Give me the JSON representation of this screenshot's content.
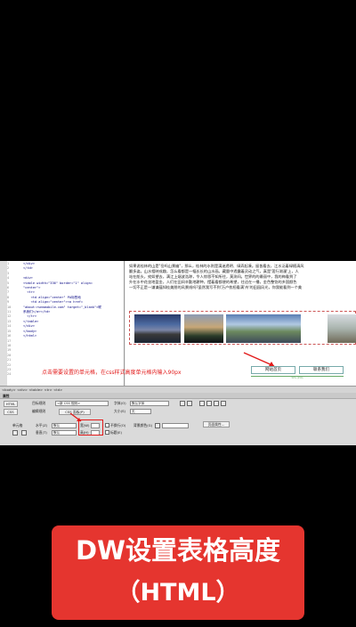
{
  "code_view": {
    "line_numbers": [
      "1",
      "2",
      "3",
      "4",
      "5",
      "6",
      "7",
      "8",
      "9",
      "10",
      "11",
      "12",
      "13",
      "14",
      "15",
      "16",
      "17",
      "18",
      "19",
      "20",
      "21",
      "22",
      "23",
      "24"
    ],
    "lines": [
      "</div>",
      "</td>",
      "",
      "<div>",
      "<table width=\"336\" border=\"1\" align=",
      "\"center\">",
      "  <tr>",
      "    <td align=\"center\" PA标签地",
      "    <td align=\"center\"><a href=",
      "\"about:rumsmobile.com\" target=\"_blank\">联",
      "系我们</a></td>",
      "  </tr>",
      "</table>",
      "</div>",
      "</body>",
      "</html>"
    ]
  },
  "design_view": {
    "paragraph_lines": [
      "如果说桂林的山是\"岳吗山景幽\"，那么，桂林的水则是漓迷透明、绿弄起凑。留皆看去，江水泛着绿随清风",
      "翻多姿。山水相映成趣，怎么看都是一幅长长的山水画。藏量中透露着灵动之气，真是'莲行湖漫'上，人",
      "站在船头，宛如望去，满江上烟波浩渺，令人惊恩不知所往，莫测间。世界的的最丽中，我的梅看到了",
      "升在水中花坐地盈金，人们在田间辛勤地耕种，摆着看都便的希望，往还在一播，金色整饬的乡国颜色",
      "一切不正是一谦谦蕴知桂美朋的风景线吗?虽然我写不到'万户枕桓看满'舟'的田园风光，你我能看到一个美"
    ],
    "instruction_note": "点击需要设置的单元格，在css样式高度单元格内输入90px",
    "link_cell_1": "网站首页",
    "link_cell_2": "联系我们",
    "width_indicator": "50% (150)"
  },
  "status_bar": {
    "text": "<body> <div> <table> <tr> <td>"
  },
  "properties": {
    "title": "属性",
    "html_tab": "HTML",
    "css_tab": "CSS",
    "target_rule_label": "目标规则",
    "target_rule_value": "<新 CSS 规则>",
    "edit_rule_label": "编辑规则",
    "css_panel_label": "CSS 面板(P)",
    "font_label": "字体(O)",
    "font_value": "默认字体",
    "size_label": "大小(S)",
    "size_value": "无",
    "cell_label": "单元格",
    "horz_label": "水平(Z)",
    "horz_value": "默认",
    "vert_label": "垂直(T)",
    "vert_value": "默认",
    "width_label": "宽(W)",
    "height_label": "高(H)",
    "nowrap_label": "不换行(O)",
    "header_label": "标题(E)",
    "bg_label": "背景颜色(G)",
    "page_props_label": "页面属性..."
  },
  "caption": {
    "line1": "DW设置表格高度",
    "line2": "（HTML）"
  },
  "colors": {
    "caption_bg": "#e5352f",
    "note_text": "#e21a1a"
  }
}
